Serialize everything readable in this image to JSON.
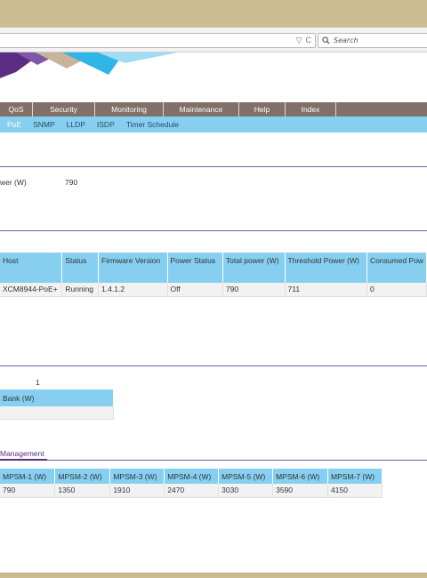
{
  "browser": {
    "search_placeholder": "Search",
    "reload_icon": "reload-icon",
    "dropdown_icon": "dropdown-arrow-icon",
    "search_icon": "magnifier-icon"
  },
  "nav": {
    "main": [
      "QoS",
      "Security",
      "Monitoring",
      "Maintenance",
      "Help",
      "Index"
    ],
    "sub": [
      "PoE",
      "SNMP",
      "LLDP",
      "ISDP",
      "Timer Schedule"
    ],
    "sub_active": "PoE"
  },
  "system": {
    "power_label_partial": "wer (W)",
    "power_value": "790"
  },
  "unit_table": {
    "headers": [
      "Host",
      "Status",
      "Firmware Version",
      "Power Status",
      "Total power (W)",
      "Threshold Power (W)",
      "Consumed Pow"
    ],
    "rows": [
      [
        "XCM8944-PoE+",
        "Running",
        "1.4.1.2",
        "Off",
        "790",
        "711",
        "0"
      ]
    ]
  },
  "bank": {
    "value": "1",
    "header_partial": "Bank (W)"
  },
  "tab": {
    "label": "Management"
  },
  "mpsm_table": {
    "headers": [
      "MPSM-1 (W)",
      "MPSM-2 (W)",
      "MPSM-3 (W)",
      "MPSM-4 (W)",
      "MPSM-5 (W)",
      "MPSM-6 (W)",
      "MPSM-7 (W)"
    ],
    "values": [
      "790",
      "1350",
      "1910",
      "2470",
      "3030",
      "3590",
      "4150"
    ]
  },
  "colors": {
    "nav_bg": "#807067",
    "subnav_bg": "#86cff0",
    "accent": "#5a2d82",
    "frame": "#cbbc92"
  }
}
